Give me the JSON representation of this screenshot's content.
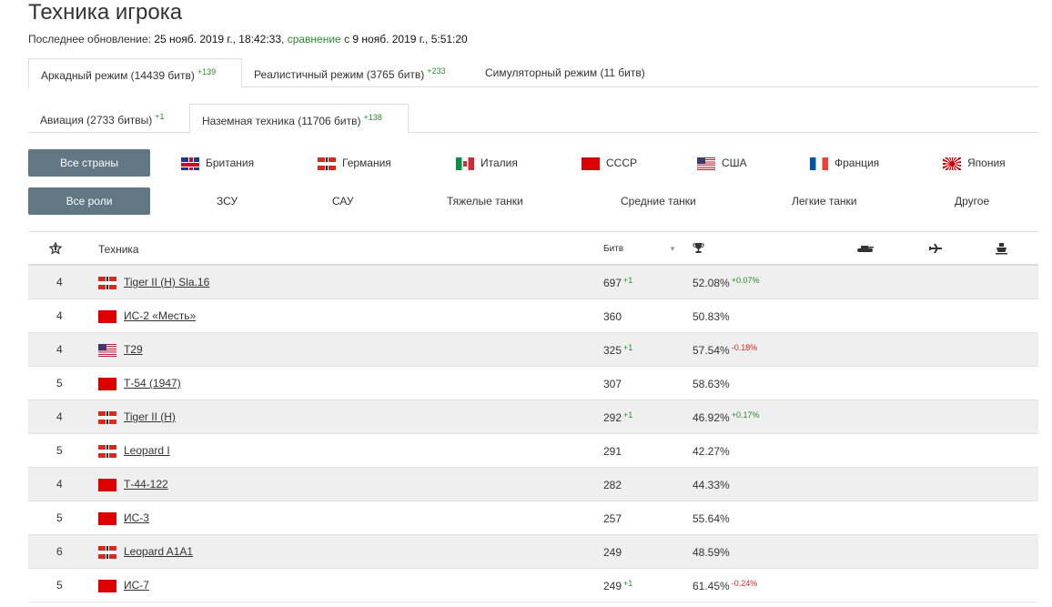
{
  "page": {
    "title": "Техника игрока",
    "update_label": "Последнее обновление:",
    "update_date": "25 нояб. 2019 г., 18:42:33",
    "compare_label": "сравнение",
    "compare_with": "с",
    "compare_date": "9 нояб. 2019 г., 5:51:20"
  },
  "mode_tabs": [
    {
      "label": "Аркадный режим (14439 битв)",
      "delta": "+139",
      "active": true
    },
    {
      "label": "Реалистичный режим (3765 битв)",
      "delta": "+233",
      "active": false
    },
    {
      "label": "Симуляторный режим (11 битв)",
      "delta": "",
      "active": false
    }
  ],
  "type_tabs": [
    {
      "label": "Авиация (2733 битвы)",
      "delta": "+1",
      "active": false
    },
    {
      "label": "Наземная техника (11706 битв)",
      "delta": "+138",
      "active": true
    }
  ],
  "countries": {
    "all_label": "Все страны",
    "items": [
      "Британия",
      "Германия",
      "Италия",
      "СССР",
      "США",
      "Франция",
      "Япония"
    ]
  },
  "roles": {
    "all_label": "Все роли",
    "items": [
      "ЗСУ",
      "САУ",
      "Тяжелые танки",
      "Средние танки",
      "Легкие танки",
      "Другое"
    ]
  },
  "table": {
    "headers": {
      "vehicle": "Техника",
      "battles": "Битв"
    },
    "rows": [
      {
        "rank": "4",
        "country": "de",
        "name": "Tiger II (H) Sla.16",
        "battles": "697",
        "battles_delta": "+1",
        "win": "52.08%",
        "win_delta": "+0.07%",
        "win_delta_sign": "plus"
      },
      {
        "rank": "4",
        "country": "su",
        "name": "ИС-2 «Месть»",
        "battles": "360",
        "battles_delta": "",
        "win": "50.83%",
        "win_delta": "",
        "win_delta_sign": ""
      },
      {
        "rank": "4",
        "country": "us",
        "name": "T29",
        "battles": "325",
        "battles_delta": "+1",
        "win": "57.54%",
        "win_delta": "-0.18%",
        "win_delta_sign": "minus"
      },
      {
        "rank": "5",
        "country": "su",
        "name": "Т-54 (1947)",
        "battles": "307",
        "battles_delta": "",
        "win": "58.63%",
        "win_delta": "",
        "win_delta_sign": ""
      },
      {
        "rank": "4",
        "country": "de",
        "name": "Tiger II (H)",
        "battles": "292",
        "battles_delta": "+1",
        "win": "46.92%",
        "win_delta": "+0.17%",
        "win_delta_sign": "plus"
      },
      {
        "rank": "5",
        "country": "de",
        "name": "Leopard I",
        "battles": "291",
        "battles_delta": "",
        "win": "42.27%",
        "win_delta": "",
        "win_delta_sign": ""
      },
      {
        "rank": "4",
        "country": "su",
        "name": "Т-44-122",
        "battles": "282",
        "battles_delta": "",
        "win": "44.33%",
        "win_delta": "",
        "win_delta_sign": ""
      },
      {
        "rank": "5",
        "country": "su",
        "name": "ИС-3",
        "battles": "257",
        "battles_delta": "",
        "win": "55.64%",
        "win_delta": "",
        "win_delta_sign": ""
      },
      {
        "rank": "6",
        "country": "de",
        "name": "Leopard A1A1",
        "battles": "249",
        "battles_delta": "",
        "win": "48.59%",
        "win_delta": "",
        "win_delta_sign": ""
      },
      {
        "rank": "5",
        "country": "su",
        "name": "ИС-7",
        "battles": "249",
        "battles_delta": "+1",
        "win": "61.45%",
        "win_delta": "-0.24%",
        "win_delta_sign": "minus"
      }
    ]
  }
}
